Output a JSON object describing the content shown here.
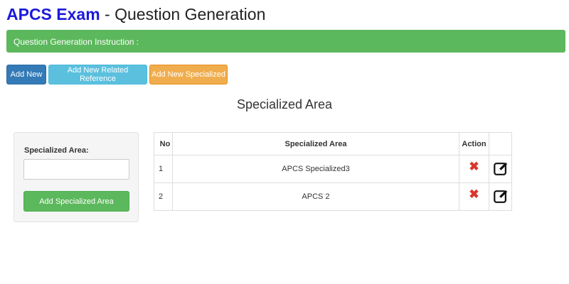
{
  "header": {
    "brand": "APCS Exam",
    "separator": " - ",
    "title": "Question Generation"
  },
  "instruction": {
    "text": "Question Generation Instruction :",
    "color": "#5cb85c"
  },
  "toolbar": {
    "add_new_label": "Add New",
    "add_related_label": "Add New Related Reference",
    "add_specialized_label": "Add New Specialized"
  },
  "section": {
    "title": "Specialized Area"
  },
  "form": {
    "label": "Specialized Area:",
    "input_value": "",
    "submit_label": "Add Specialized Area"
  },
  "table": {
    "headers": {
      "no": "No",
      "area": "Specialized Area",
      "action": "Action"
    },
    "rows": [
      {
        "no": "1",
        "area": "APCS Specialized3",
        "delete_icon": "delete-icon",
        "edit_icon": "edit-icon"
      },
      {
        "no": "2",
        "area": "APCS 2",
        "delete_icon": "delete-icon",
        "edit_icon": "edit-icon"
      }
    ]
  },
  "colors": {
    "brand": "#1a1adb",
    "primary": "#337ab7",
    "info": "#5bc0de",
    "warning": "#f0ad4e",
    "success": "#5cb85c",
    "danger": "#d9362b"
  }
}
